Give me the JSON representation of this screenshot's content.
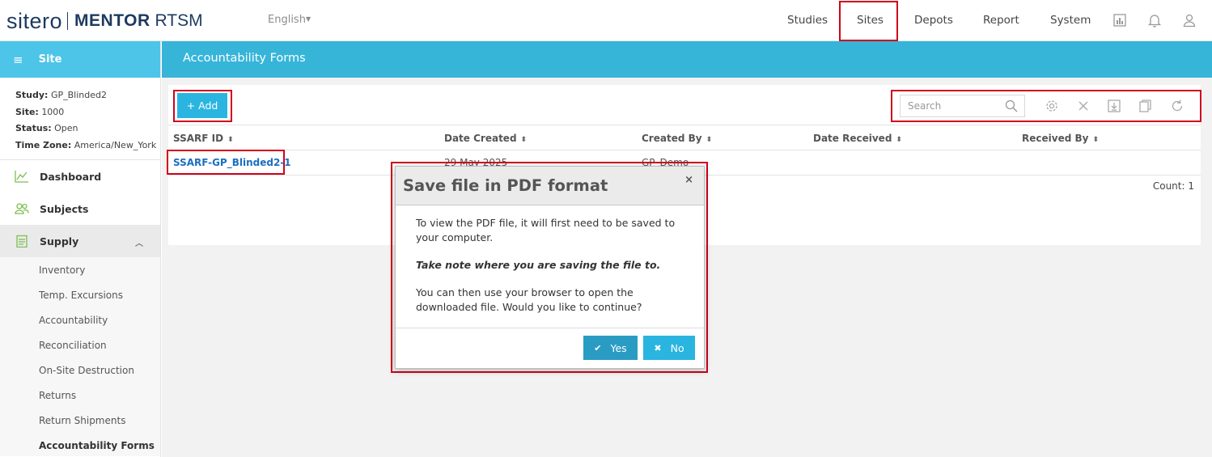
{
  "header": {
    "brand": "sitero",
    "product_bold": "MENTOR",
    "product_rest": "RTSM",
    "language": "English",
    "nav": [
      "Studies",
      "Sites",
      "Depots",
      "Report",
      "System"
    ]
  },
  "sidebar": {
    "title": "Site",
    "info": {
      "study_label": "Study:",
      "study_value": "GP_Blinded2",
      "site_label": "Site:",
      "site_value": "1000",
      "status_label": "Status:",
      "status_value": "Open",
      "tz_label": "Time Zone:",
      "tz_value": "America/New_York"
    },
    "items": [
      {
        "label": "Dashboard",
        "icon": "chart-line-icon"
      },
      {
        "label": "Subjects",
        "icon": "users-icon"
      },
      {
        "label": "Supply",
        "icon": "clipboard-icon"
      }
    ],
    "sub_items": [
      "Inventory",
      "Temp. Excursions",
      "Accountability",
      "Reconciliation",
      "On-Site Destruction",
      "Returns",
      "Return Shipments",
      "Accountability Forms"
    ]
  },
  "main": {
    "page_title": "Accountability Forms",
    "add_label": "+ Add",
    "search_placeholder": "Search",
    "columns": [
      "SSARF ID",
      "Date Created",
      "Created By",
      "Date Received",
      "Received By"
    ],
    "rows": [
      {
        "id": "SSARF-GP_Blinded2-1",
        "date_created": "29 May 2025",
        "created_by": "GP_Demo",
        "date_received": "",
        "received_by": ""
      }
    ],
    "count": "Count: 1"
  },
  "modal": {
    "title": "Save file in PDF format",
    "close": "×",
    "p1": "To view the PDF file, it will first need to be saved to your computer.",
    "p2": "Take note where you are saving the file to.",
    "p3": "You can then use your browser to open the downloaded file. Would you like to continue?",
    "yes": "Yes",
    "no": "No"
  },
  "colors": {
    "accent": "#37b5d9",
    "sidebar_head": "#4cc5e8",
    "highlight": "#d0021b",
    "link": "#1a6fc2"
  }
}
